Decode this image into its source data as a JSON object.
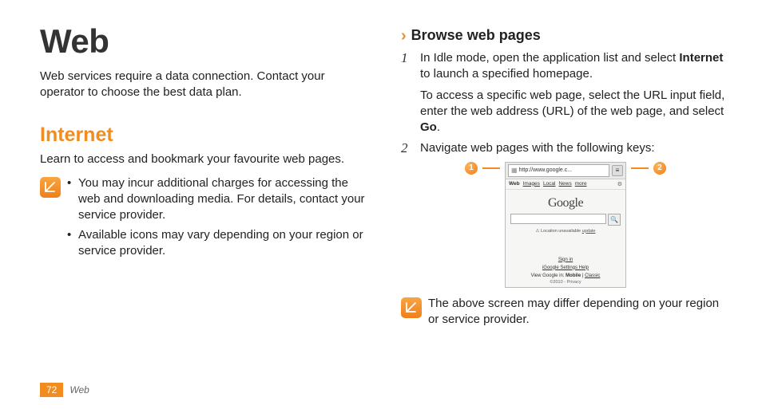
{
  "page": {
    "title": "Web",
    "intro": "Web services require a data connection. Contact your operator to choose the best data plan.",
    "section": {
      "heading": "Internet",
      "sub": "Learn to access and bookmark your favourite web pages.",
      "notes": [
        "You may incur additional charges for accessing the web and downloading media. For details, contact your service provider.",
        "Available icons may vary depending on your region or service provider."
      ]
    },
    "browse": {
      "chevron": "›",
      "heading": "Browse web pages",
      "steps": [
        {
          "num": "1",
          "paras": [
            {
              "pre": "In Idle mode, open the application list and select ",
              "bold": "Internet",
              "post": " to launch a specified homepage."
            },
            {
              "pre": "To access a specific web page, select the URL input field, enter the web address (URL) of the web page, and select ",
              "bold": "Go",
              "post": "."
            }
          ]
        },
        {
          "num": "2",
          "paras": [
            {
              "pre": "Navigate web pages with the following keys:",
              "bold": "",
              "post": ""
            }
          ]
        }
      ],
      "callouts": {
        "left": "1",
        "right": "2"
      },
      "screen_note": "The above screen may differ depending on your region or service provider."
    },
    "mock": {
      "url": "http://www.google.c...",
      "tabs": [
        "Web",
        "Images",
        "Local",
        "News",
        "more"
      ],
      "logo": "Google",
      "location_pre": "Location unavailable ",
      "location_link": "update",
      "signin": "Sign in",
      "links_row": "iGoogle   Settings   Help",
      "view_row_pre": "View Google in: ",
      "view_row_bold": "Mobile",
      "view_row_sep": "  |  ",
      "view_row_link": "Classic",
      "copyright": "©2010 - Privacy"
    },
    "footer": {
      "page_number": "72",
      "section_name": "Web"
    }
  }
}
